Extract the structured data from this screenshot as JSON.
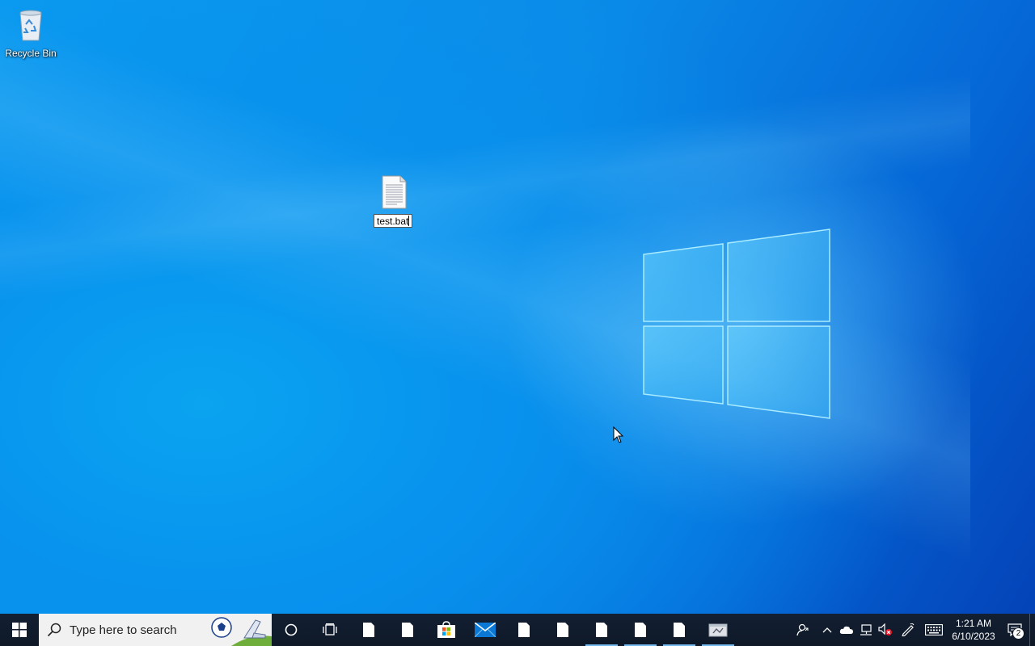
{
  "desktop": {
    "icons": [
      {
        "label": "Recycle Bin",
        "icon": "recycle-bin-icon"
      },
      {
        "label": "test.bat",
        "icon": "batch-file-icon",
        "renaming": true
      }
    ]
  },
  "taskbar": {
    "search_placeholder": "Type here to search",
    "pinned": [
      {
        "name": "cortana-icon"
      },
      {
        "name": "task-view-icon"
      },
      {
        "name": "file-icon"
      },
      {
        "name": "file-icon"
      },
      {
        "name": "microsoft-store-icon"
      },
      {
        "name": "mail-icon"
      },
      {
        "name": "file-icon"
      },
      {
        "name": "file-icon"
      },
      {
        "name": "file-icon",
        "active": true
      },
      {
        "name": "file-icon",
        "active": true
      },
      {
        "name": "file-icon",
        "active": true
      },
      {
        "name": "app-icon",
        "active": true
      }
    ],
    "tray": {
      "icons": [
        "people-icon",
        "chevron-up-icon",
        "onedrive-icon",
        "network-icon",
        "volume-muted-icon",
        "pen-icon",
        "keyboard-icon"
      ],
      "time": "1:21 AM",
      "date": "6/10/2023",
      "notification_count": "2"
    }
  },
  "colors": {
    "taskbar_bg": "#101a28",
    "desktop_blue": "#0a8ae8",
    "active_indicator": "#76b9ed"
  }
}
